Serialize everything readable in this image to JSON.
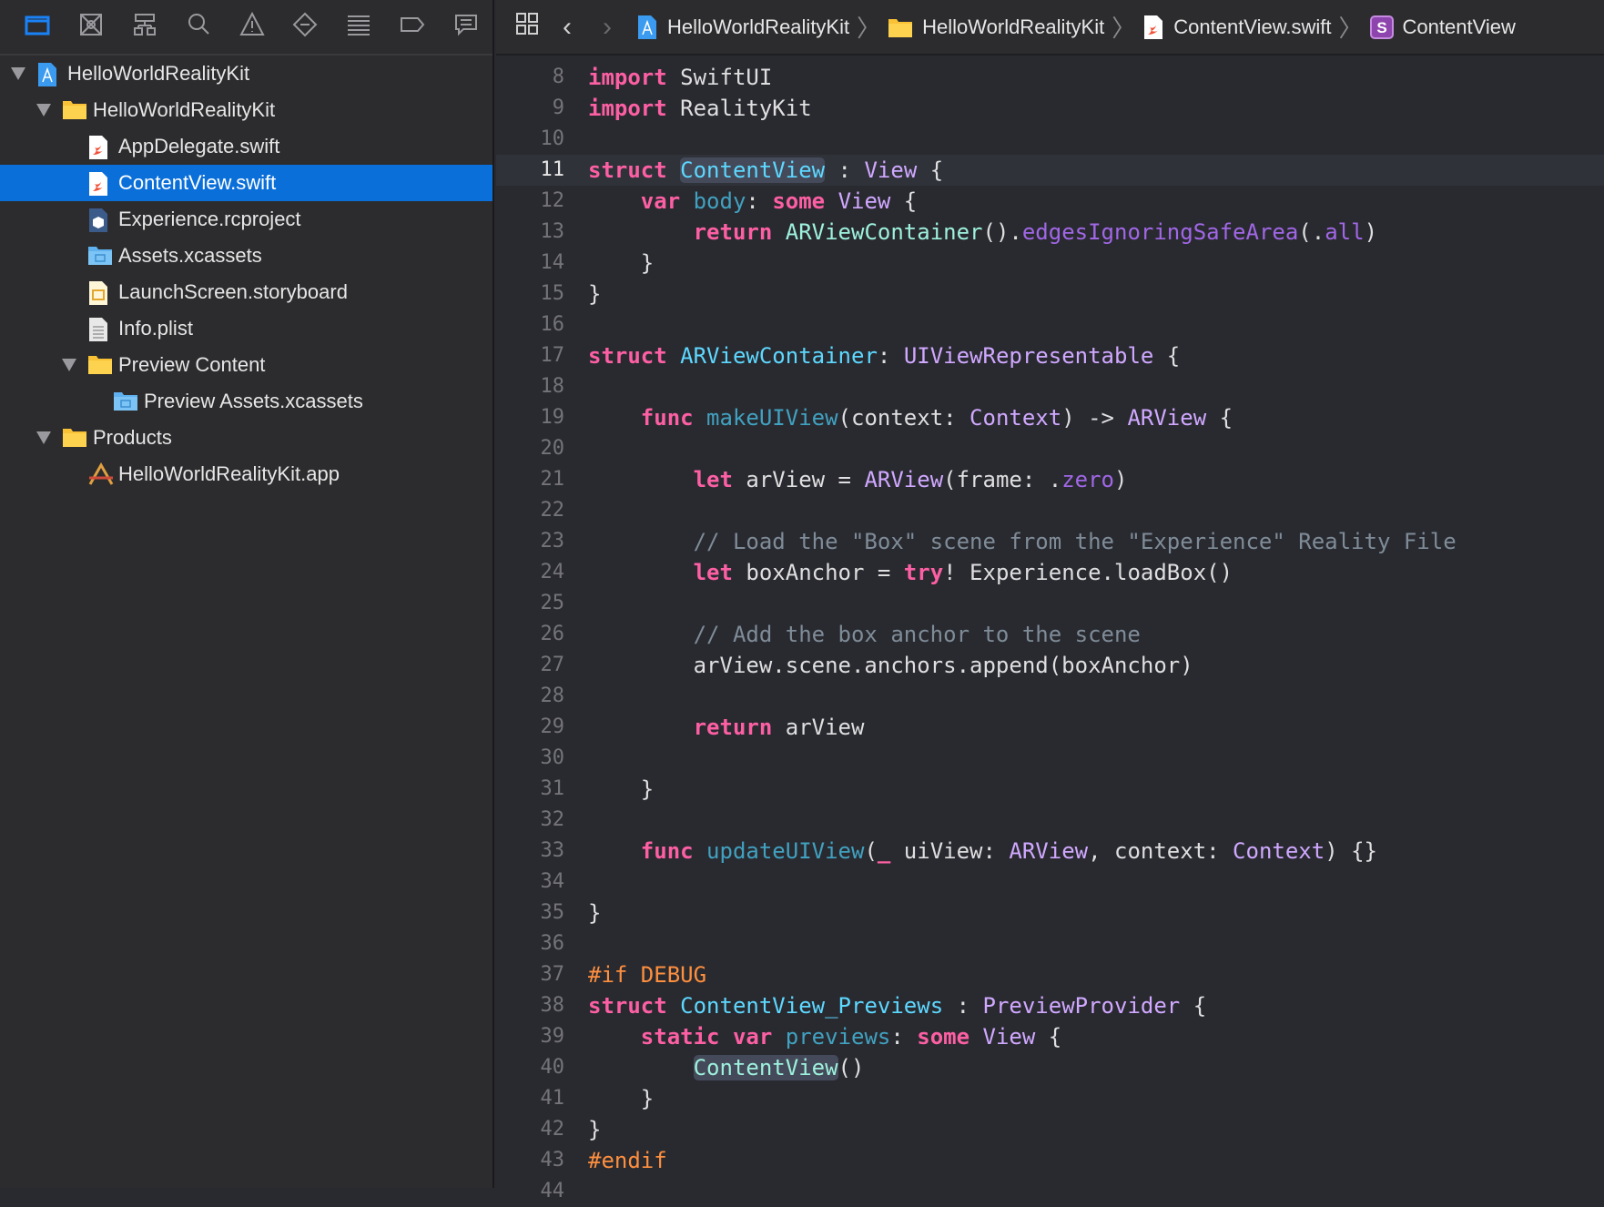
{
  "navigator": {
    "tabs": [
      "project-navigator",
      "source-control-navigator",
      "symbol-navigator",
      "find-navigator",
      "issue-navigator",
      "test-navigator",
      "debug-navigator",
      "breakpoint-navigator",
      "report-navigator"
    ],
    "active_tab": 0,
    "tree": [
      {
        "label": "HelloWorldRealityKit",
        "level": 0,
        "icon": "xcode-project-icon",
        "expanded": true
      },
      {
        "label": "HelloWorldRealityKit",
        "level": 1,
        "icon": "folder-icon",
        "expanded": true
      },
      {
        "label": "AppDelegate.swift",
        "level": 2,
        "icon": "swift-file-icon"
      },
      {
        "label": "ContentView.swift",
        "level": 2,
        "icon": "swift-file-icon",
        "selected": true
      },
      {
        "label": "Experience.rcproject",
        "level": 2,
        "icon": "reality-composer-icon"
      },
      {
        "label": "Assets.xcassets",
        "level": 2,
        "icon": "asset-catalog-icon"
      },
      {
        "label": "LaunchScreen.storyboard",
        "level": 2,
        "icon": "storyboard-icon"
      },
      {
        "label": "Info.plist",
        "level": 2,
        "icon": "plist-icon"
      },
      {
        "label": "Preview Content",
        "level": 2,
        "icon": "folder-icon",
        "expanded": true
      },
      {
        "label": "Preview Assets.xcassets",
        "level": 3,
        "icon": "asset-catalog-icon"
      },
      {
        "label": "Products",
        "level": 1,
        "icon": "folder-icon",
        "expanded": true
      },
      {
        "label": "HelloWorldRealityKit.app",
        "level": 2,
        "icon": "app-icon"
      }
    ]
  },
  "jumpbar": {
    "crumbs": [
      {
        "label": "HelloWorldRealityKit",
        "icon": "xcode-project-icon"
      },
      {
        "label": "HelloWorldRealityKit",
        "icon": "folder-icon"
      },
      {
        "label": "ContentView.swift",
        "icon": "swift-file-icon"
      },
      {
        "label": "ContentView",
        "icon": "struct-icon"
      }
    ],
    "struct_badge": "S"
  },
  "editor": {
    "current_line": 11,
    "lines": [
      {
        "n": "8",
        "t": [
          [
            "kw",
            "import"
          ],
          [
            "pl",
            " SwiftUI"
          ]
        ]
      },
      {
        "n": "9",
        "t": [
          [
            "kw",
            "import"
          ],
          [
            "pl",
            " RealityKit"
          ]
        ]
      },
      {
        "n": "10",
        "t": []
      },
      {
        "n": "11",
        "t": [
          [
            "kw",
            "struct"
          ],
          [
            "pl",
            " "
          ],
          [
            "dt hl",
            "ContentView"
          ],
          [
            "pl",
            " : "
          ],
          [
            "ot",
            "View"
          ],
          [
            "pl",
            " {"
          ]
        ]
      },
      {
        "n": "12",
        "t": [
          [
            "pl",
            "    "
          ],
          [
            "kw",
            "var"
          ],
          [
            "pl",
            " "
          ],
          [
            "dc",
            "body"
          ],
          [
            "pl",
            ": "
          ],
          [
            "kw",
            "some"
          ],
          [
            "pl",
            " "
          ],
          [
            "ot",
            "View"
          ],
          [
            "pl",
            " {"
          ]
        ]
      },
      {
        "n": "13",
        "t": [
          [
            "pl",
            "        "
          ],
          [
            "kw",
            "return"
          ],
          [
            "pl",
            " "
          ],
          [
            "pt",
            "ARViewContainer"
          ],
          [
            "pl",
            "()."
          ],
          [
            "of",
            "edgesIgnoringSafeArea"
          ],
          [
            "pl",
            "(."
          ],
          [
            "of",
            "all"
          ],
          [
            "pl",
            ")"
          ]
        ]
      },
      {
        "n": "14",
        "t": [
          [
            "pl",
            "    }"
          ]
        ]
      },
      {
        "n": "15",
        "t": [
          [
            "pl",
            "}"
          ]
        ]
      },
      {
        "n": "16",
        "t": []
      },
      {
        "n": "17",
        "t": [
          [
            "kw",
            "struct"
          ],
          [
            "pl",
            " "
          ],
          [
            "dt",
            "ARViewContainer"
          ],
          [
            "pl",
            ": "
          ],
          [
            "ot",
            "UIViewRepresentable"
          ],
          [
            "pl",
            " {"
          ]
        ]
      },
      {
        "n": "18",
        "t": []
      },
      {
        "n": "19",
        "t": [
          [
            "pl",
            "    "
          ],
          [
            "kw",
            "func"
          ],
          [
            "pl",
            " "
          ],
          [
            "dc",
            "makeUIView"
          ],
          [
            "pl",
            "(context: "
          ],
          [
            "ot",
            "Context"
          ],
          [
            "pl",
            ") -> "
          ],
          [
            "ot",
            "ARView"
          ],
          [
            "pl",
            " {"
          ]
        ]
      },
      {
        "n": "20",
        "t": []
      },
      {
        "n": "21",
        "t": [
          [
            "pl",
            "        "
          ],
          [
            "kw",
            "let"
          ],
          [
            "pl",
            " arView = "
          ],
          [
            "ot",
            "ARView"
          ],
          [
            "pl",
            "(frame: ."
          ],
          [
            "of",
            "zero"
          ],
          [
            "pl",
            ")"
          ]
        ]
      },
      {
        "n": "22",
        "t": []
      },
      {
        "n": "23",
        "t": [
          [
            "pl",
            "        "
          ],
          [
            "cm",
            "// Load the \"Box\" scene from the \"Experience\" Reality File"
          ]
        ]
      },
      {
        "n": "24",
        "t": [
          [
            "pl",
            "        "
          ],
          [
            "kw",
            "let"
          ],
          [
            "pl",
            " boxAnchor = "
          ],
          [
            "kw",
            "try"
          ],
          [
            "pl",
            "! Experience.loadBox()"
          ]
        ]
      },
      {
        "n": "25",
        "t": []
      },
      {
        "n": "26",
        "t": [
          [
            "pl",
            "        "
          ],
          [
            "cm",
            "// Add the box anchor to the scene"
          ]
        ]
      },
      {
        "n": "27",
        "t": [
          [
            "pl",
            "        arView.scene.anchors.append(boxAnchor)"
          ]
        ]
      },
      {
        "n": "28",
        "t": []
      },
      {
        "n": "29",
        "t": [
          [
            "pl",
            "        "
          ],
          [
            "kw",
            "return"
          ],
          [
            "pl",
            " arView"
          ]
        ]
      },
      {
        "n": "30",
        "t": []
      },
      {
        "n": "31",
        "t": [
          [
            "pl",
            "    }"
          ]
        ]
      },
      {
        "n": "32",
        "t": []
      },
      {
        "n": "33",
        "t": [
          [
            "pl",
            "    "
          ],
          [
            "kw",
            "func"
          ],
          [
            "pl",
            " "
          ],
          [
            "dc",
            "updateUIView"
          ],
          [
            "pl",
            "("
          ],
          [
            "kw",
            "_"
          ],
          [
            "pl",
            " uiView: "
          ],
          [
            "ot",
            "ARView"
          ],
          [
            "pl",
            ", context: "
          ],
          [
            "ot",
            "Context"
          ],
          [
            "pl",
            ") {}"
          ]
        ]
      },
      {
        "n": "34",
        "t": []
      },
      {
        "n": "35",
        "t": [
          [
            "pl",
            "}"
          ]
        ]
      },
      {
        "n": "36",
        "t": []
      },
      {
        "n": "37",
        "t": [
          [
            "pp",
            "#if DEBUG"
          ]
        ]
      },
      {
        "n": "38",
        "t": [
          [
            "kw",
            "struct"
          ],
          [
            "pl",
            " "
          ],
          [
            "dt",
            "ContentView_Previews"
          ],
          [
            "pl",
            " : "
          ],
          [
            "ot",
            "PreviewProvider"
          ],
          [
            "pl",
            " {"
          ]
        ]
      },
      {
        "n": "39",
        "t": [
          [
            "pl",
            "    "
          ],
          [
            "kw",
            "static"
          ],
          [
            "pl",
            " "
          ],
          [
            "kw",
            "var"
          ],
          [
            "pl",
            " "
          ],
          [
            "dc",
            "previews"
          ],
          [
            "pl",
            ": "
          ],
          [
            "kw",
            "some"
          ],
          [
            "pl",
            " "
          ],
          [
            "ot",
            "View"
          ],
          [
            "pl",
            " {"
          ]
        ]
      },
      {
        "n": "40",
        "t": [
          [
            "pl",
            "        "
          ],
          [
            "pt hl",
            "ContentView"
          ],
          [
            "pl",
            "()"
          ]
        ]
      },
      {
        "n": "41",
        "t": [
          [
            "pl",
            "    }"
          ]
        ]
      },
      {
        "n": "42",
        "t": [
          [
            "pl",
            "}"
          ]
        ]
      },
      {
        "n": "43",
        "t": [
          [
            "pp",
            "#endif"
          ]
        ]
      },
      {
        "n": "44",
        "t": []
      }
    ]
  }
}
